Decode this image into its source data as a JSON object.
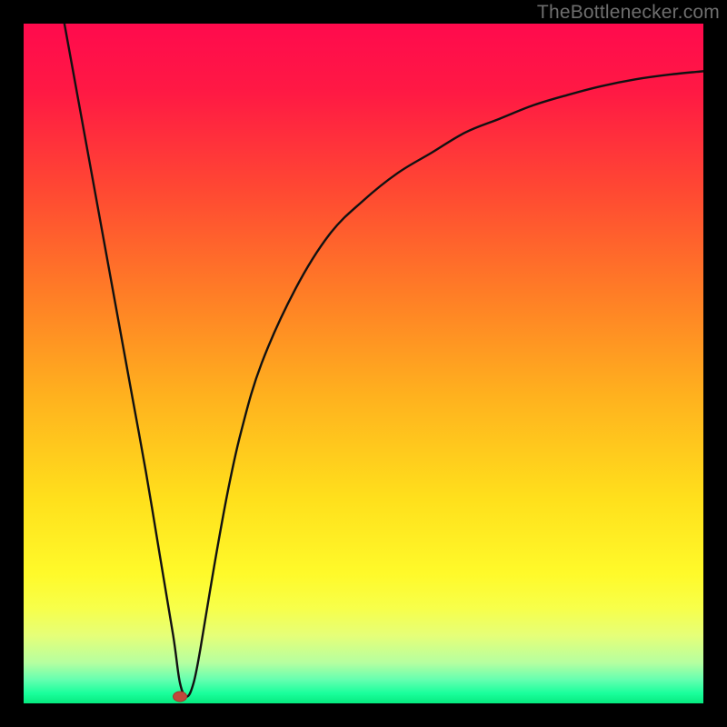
{
  "attribution": "TheBottlenecker.com",
  "colors": {
    "frame": "#000000",
    "gradient_stops": [
      {
        "offset": 0.0,
        "color": "#ff0a4d"
      },
      {
        "offset": 0.1,
        "color": "#ff1944"
      },
      {
        "offset": 0.25,
        "color": "#ff4a32"
      },
      {
        "offset": 0.4,
        "color": "#ff7e26"
      },
      {
        "offset": 0.55,
        "color": "#ffb21e"
      },
      {
        "offset": 0.7,
        "color": "#ffe01c"
      },
      {
        "offset": 0.81,
        "color": "#fffa2a"
      },
      {
        "offset": 0.86,
        "color": "#f7ff4a"
      },
      {
        "offset": 0.9,
        "color": "#e6ff78"
      },
      {
        "offset": 0.94,
        "color": "#b6ffa0"
      },
      {
        "offset": 0.965,
        "color": "#66ffb0"
      },
      {
        "offset": 0.985,
        "color": "#1aff9c"
      },
      {
        "offset": 1.0,
        "color": "#06e97f"
      }
    ],
    "curve": "#111111",
    "marker_fill": "#c1483b",
    "marker_stroke": "#a1362c"
  },
  "chart_data": {
    "type": "line",
    "title": "",
    "xlabel": "",
    "ylabel": "",
    "xlim": [
      0,
      100
    ],
    "ylim": [
      0,
      100
    ],
    "x": [
      6,
      8,
      10,
      12,
      14,
      16,
      18,
      20,
      22,
      23,
      24,
      25,
      26,
      28,
      30,
      32,
      35,
      40,
      45,
      50,
      55,
      60,
      65,
      70,
      75,
      80,
      85,
      90,
      95,
      100
    ],
    "values": [
      100,
      89,
      78,
      67,
      56,
      45,
      34,
      22,
      10,
      3,
      1,
      3,
      8,
      20,
      31,
      40,
      50,
      61,
      69,
      74,
      78,
      81,
      84,
      86,
      88,
      89.5,
      90.8,
      91.8,
      92.5,
      93
    ],
    "marker": {
      "x": 23,
      "y": 1
    },
    "notes": "V-shaped bottleneck curve; minimum near x≈23. Values read as percentage of plot height from bottom."
  }
}
